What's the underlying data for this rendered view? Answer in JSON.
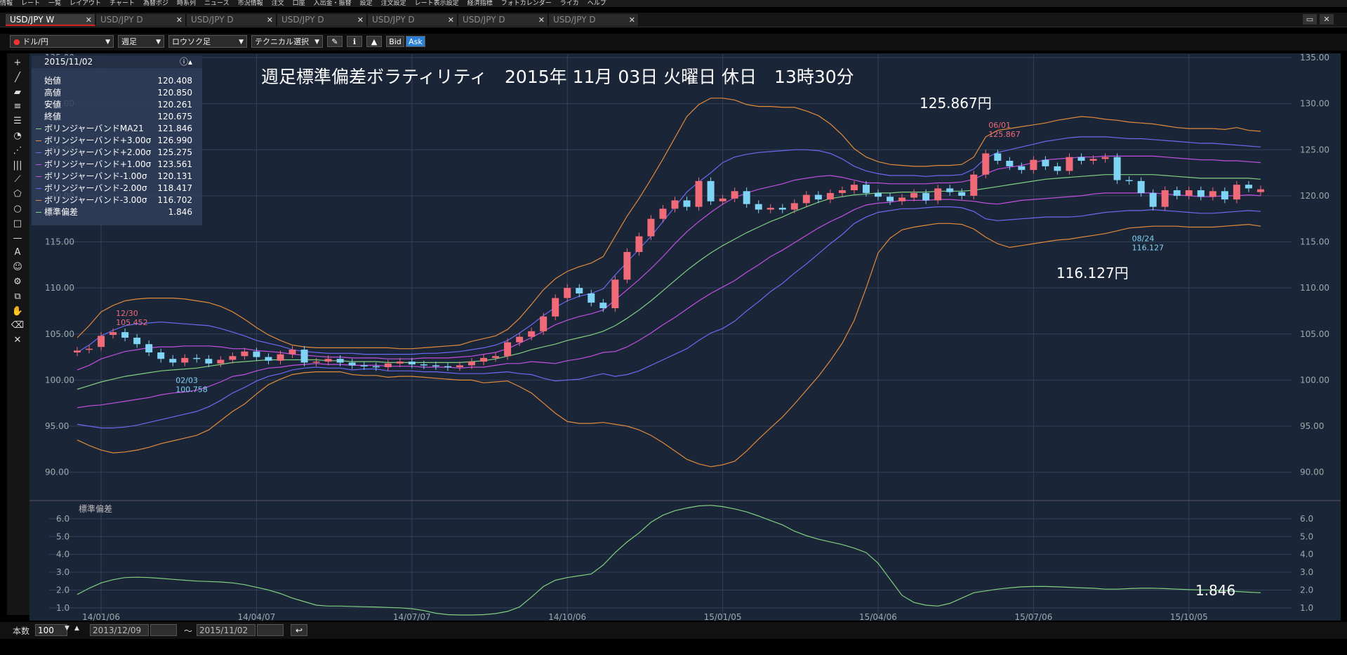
{
  "menu": [
    "情報",
    "レート",
    "一覧",
    "レイアウト",
    "チャート",
    "為替ポジ",
    "時系列",
    "ニュース",
    "市況情報",
    "注文",
    "口座",
    "入出金・振替",
    "設定",
    "注文設定",
    "レート表示設定",
    "経済指標",
    "フォトカレンダー",
    "ライカ",
    "ヘルプ"
  ],
  "tabs": [
    {
      "label": "USD/JPY W",
      "active": true
    },
    {
      "label": "USD/JPY D",
      "active": false
    },
    {
      "label": "USD/JPY D",
      "active": false
    },
    {
      "label": "USD/JPY D",
      "active": false
    },
    {
      "label": "USD/JPY D",
      "active": false
    },
    {
      "label": "USD/JPY D",
      "active": false
    },
    {
      "label": "USD/JPY D",
      "active": false
    }
  ],
  "toolbar": {
    "pair": "ドル/円",
    "period": "週足",
    "chart_type": "ロウソク足",
    "technical": "テクニカル選択",
    "bid": "Bid",
    "ask": "Ask"
  },
  "title": "週足標準偏差ボラティリティ　2015年 11月 03日 火曜日 休日　13時30分",
  "notes": {
    "high": "125.867円",
    "low": "116.127円",
    "std": "1.846"
  },
  "info": {
    "date": "2015/11/02",
    "rows": [
      {
        "label": "始値",
        "value": "120.408",
        "color": ""
      },
      {
        "label": "高値",
        "value": "120.850",
        "color": ""
      },
      {
        "label": "安値",
        "value": "120.261",
        "color": ""
      },
      {
        "label": "終値",
        "value": "120.675",
        "color": ""
      },
      {
        "label": "ボリンジャーバンドMA21",
        "value": "121.846",
        "color": "#7fd07f"
      },
      {
        "label": "ボリンジャーバンド+3.00σ",
        "value": "126.990",
        "color": "#e08a3a"
      },
      {
        "label": "ボリンジャーバンド+2.00σ",
        "value": "125.275",
        "color": "#6a6af0"
      },
      {
        "label": "ボリンジャーバンド+1.00σ",
        "value": "123.561",
        "color": "#c050e0"
      },
      {
        "label": "ボリンジャーバンド-1.00σ",
        "value": "120.131",
        "color": "#c050e0"
      },
      {
        "label": "ボリンジャーバンド-2.00σ",
        "value": "118.417",
        "color": "#6a6af0"
      },
      {
        "label": "ボリンジャーバンド-3.00σ",
        "value": "116.702",
        "color": "#e08a3a"
      },
      {
        "label": "標準偏差",
        "value": "1.846",
        "color": "#7fd07f"
      }
    ]
  },
  "sub_panel_label": "標準偏差",
  "bottom": {
    "count_label": "本数",
    "count": "100",
    "from": "2013/12/09",
    "tilde": "〜",
    "to": "2015/11/02"
  },
  "colors": {
    "up": "#f06a78",
    "down": "#7fd4f5",
    "bg": "#1b2538",
    "ma": "#7fd07f",
    "s3": "#e08a3a",
    "s2": "#6a6af0",
    "s1": "#c050e0"
  },
  "chart_data": {
    "type": "line",
    "ylim": [
      87,
      135
    ],
    "y_ticks": [
      90,
      95,
      100,
      105,
      110,
      115,
      120,
      125,
      130,
      135
    ],
    "x_tick_labels": [
      "14/01/06",
      "14/04/07",
      "14/07/07",
      "14/10/06",
      "15/01/05",
      "15/04/06",
      "15/07/06",
      "15/10/05"
    ],
    "x_tick_index": [
      2,
      15,
      28,
      41,
      54,
      67,
      80,
      93
    ],
    "annotations": [
      {
        "label": "12/30",
        "value": "105.452",
        "index": 3
      },
      {
        "label": "02/03",
        "value": "100.758",
        "index": 8
      },
      {
        "label": "06/01",
        "value": "125.867",
        "index": 76
      },
      {
        "label": "08/24",
        "value": "116.127",
        "index": 88
      }
    ],
    "close": [
      103.2,
      103.4,
      104.8,
      105.2,
      104.6,
      103.9,
      103.0,
      102.3,
      101.9,
      102.4,
      102.3,
      101.8,
      102.2,
      102.6,
      103.1,
      102.5,
      102.1,
      102.8,
      103.3,
      101.9,
      102.0,
      102.3,
      101.9,
      101.6,
      101.5,
      101.4,
      101.8,
      102.0,
      101.7,
      101.6,
      101.5,
      101.4,
      101.6,
      102.0,
      102.4,
      102.6,
      104.1,
      104.7,
      105.3,
      106.9,
      108.9,
      110.0,
      109.4,
      108.4,
      107.8,
      110.9,
      113.9,
      115.6,
      117.5,
      118.6,
      119.5,
      118.8,
      121.6,
      119.4,
      119.7,
      120.5,
      119.1,
      118.5,
      118.7,
      118.5,
      119.2,
      120.1,
      119.6,
      120.3,
      120.6,
      121.2,
      120.3,
      119.9,
      119.4,
      119.8,
      120.3,
      119.5,
      120.8,
      120.4,
      120.0,
      122.3,
      124.6,
      123.8,
      123.2,
      122.8,
      123.9,
      123.2,
      122.7,
      124.2,
      123.8,
      124.0,
      124.2,
      121.7,
      121.6,
      120.3,
      118.8,
      120.6,
      120.0,
      120.6,
      119.9,
      120.5,
      119.6,
      121.2,
      120.8,
      120.7
    ],
    "open": [
      103.0,
      103.3,
      103.6,
      104.9,
      105.2,
      104.6,
      103.9,
      103.0,
      102.3,
      101.9,
      102.4,
      102.3,
      101.8,
      102.2,
      102.6,
      103.1,
      102.5,
      102.1,
      102.8,
      103.3,
      101.9,
      102.0,
      102.3,
      101.9,
      101.6,
      101.5,
      101.4,
      101.8,
      102.0,
      101.7,
      101.6,
      101.5,
      101.4,
      101.6,
      102.0,
      102.4,
      102.6,
      104.1,
      104.7,
      105.3,
      106.9,
      108.9,
      110.0,
      109.4,
      108.4,
      107.8,
      110.9,
      113.9,
      115.6,
      117.5,
      118.6,
      119.5,
      118.8,
      121.6,
      119.4,
      119.7,
      120.5,
      119.1,
      118.5,
      118.7,
      118.5,
      119.2,
      120.1,
      119.6,
      120.3,
      120.6,
      121.2,
      120.3,
      119.9,
      119.4,
      119.8,
      120.3,
      119.5,
      120.8,
      120.4,
      120.0,
      122.3,
      124.6,
      123.8,
      123.2,
      122.8,
      123.9,
      123.2,
      122.7,
      124.2,
      123.8,
      124.0,
      124.2,
      121.7,
      121.6,
      120.3,
      118.8,
      120.6,
      120.0,
      120.6,
      119.9,
      120.5,
      119.6,
      121.2,
      120.4
    ],
    "ma21": [
      99.0,
      99.4,
      99.8,
      100.1,
      100.4,
      100.6,
      100.8,
      101.0,
      101.1,
      101.2,
      101.3,
      101.5,
      101.7,
      101.9,
      102.0,
      102.1,
      102.2,
      102.2,
      102.2,
      102.2,
      102.2,
      102.1,
      102.1,
      102.0,
      102.0,
      102.0,
      101.9,
      101.9,
      101.9,
      101.9,
      101.9,
      101.9,
      101.9,
      102.0,
      102.1,
      102.3,
      102.6,
      102.9,
      103.3,
      103.6,
      103.9,
      104.3,
      104.6,
      104.9,
      105.3,
      105.9,
      106.7,
      107.6,
      108.6,
      109.7,
      110.8,
      111.9,
      112.9,
      113.8,
      114.6,
      115.3,
      116.0,
      116.6,
      117.2,
      117.7,
      118.3,
      118.8,
      119.3,
      119.7,
      119.9,
      120.1,
      120.2,
      120.3,
      120.3,
      120.4,
      120.4,
      120.4,
      120.5,
      120.5,
      120.5,
      120.6,
      120.8,
      121.0,
      121.2,
      121.4,
      121.6,
      121.8,
      121.9,
      122.0,
      122.1,
      122.2,
      122.3,
      122.3,
      122.3,
      122.3,
      122.3,
      122.2,
      122.1,
      122.0,
      121.9,
      121.9,
      121.9,
      121.9,
      121.9,
      121.8
    ],
    "upper3": [
      104.6,
      105.9,
      107.4,
      108.1,
      108.6,
      108.8,
      108.9,
      108.9,
      108.9,
      108.8,
      108.6,
      108.4,
      108.0,
      107.4,
      106.6,
      105.7,
      104.9,
      104.3,
      103.8,
      103.6,
      103.5,
      103.5,
      103.5,
      103.5,
      103.5,
      103.5,
      103.5,
      103.4,
      103.4,
      103.5,
      103.6,
      103.7,
      103.8,
      104.2,
      104.5,
      104.8,
      105.5,
      106.7,
      108.2,
      109.8,
      111.0,
      111.8,
      112.3,
      112.7,
      113.4,
      115.6,
      117.8,
      119.7,
      121.8,
      124.0,
      126.3,
      128.6,
      129.9,
      130.6,
      130.6,
      130.4,
      129.9,
      129.7,
      129.7,
      129.6,
      129.6,
      129.2,
      128.7,
      127.8,
      126.6,
      125.1,
      124.2,
      123.7,
      123.4,
      123.3,
      123.2,
      123.2,
      123.3,
      123.3,
      123.4,
      124.2,
      126.4,
      127.1,
      127.3,
      127.5,
      127.7,
      127.9,
      128.2,
      128.4,
      128.6,
      128.5,
      128.3,
      128.2,
      128.0,
      127.9,
      127.8,
      127.6,
      127.4,
      127.3,
      127.3,
      127.3,
      127.2,
      127.4,
      127.1,
      127.0
    ],
    "upper2": [
      103.0,
      103.8,
      104.8,
      105.4,
      105.9,
      106.1,
      106.2,
      106.3,
      106.2,
      106.1,
      106.0,
      105.9,
      105.6,
      105.2,
      104.8,
      104.3,
      104.0,
      103.7,
      103.3,
      103.1,
      103.0,
      102.9,
      102.9,
      102.9,
      102.8,
      102.8,
      102.8,
      102.8,
      102.8,
      102.9,
      102.9,
      103.0,
      103.1,
      103.3,
      103.5,
      103.8,
      104.3,
      105.1,
      106.0,
      107.0,
      107.9,
      108.6,
      109.1,
      109.4,
      109.9,
      111.4,
      112.8,
      114.2,
      115.6,
      117.2,
      118.8,
      120.4,
      121.5,
      122.5,
      123.6,
      124.2,
      124.5,
      124.7,
      124.8,
      124.9,
      125.0,
      125.0,
      124.9,
      124.6,
      124.0,
      123.2,
      122.7,
      122.4,
      122.2,
      122.2,
      122.2,
      122.1,
      122.2,
      122.2,
      122.3,
      122.9,
      124.1,
      124.7,
      125.0,
      125.3,
      125.6,
      125.9,
      126.1,
      126.3,
      126.4,
      126.4,
      126.4,
      126.3,
      126.2,
      126.2,
      126.1,
      126.0,
      125.9,
      125.8,
      125.7,
      125.7,
      125.6,
      125.5,
      125.4,
      125.3
    ],
    "upper1": [
      101.1,
      101.6,
      102.3,
      102.7,
      103.1,
      103.3,
      103.5,
      103.6,
      103.6,
      103.7,
      103.7,
      103.7,
      103.6,
      103.4,
      103.4,
      103.2,
      103.1,
      103.0,
      102.8,
      102.7,
      102.6,
      102.5,
      102.5,
      102.4,
      102.4,
      102.4,
      102.3,
      102.3,
      102.3,
      102.4,
      102.4,
      102.4,
      102.5,
      102.6,
      102.8,
      103.0,
      103.4,
      104.0,
      104.6,
      105.3,
      106.0,
      106.5,
      106.9,
      107.2,
      107.6,
      108.7,
      109.8,
      110.9,
      112.1,
      113.4,
      114.8,
      116.1,
      117.2,
      118.2,
      119.1,
      119.8,
      120.3,
      120.7,
      121.0,
      121.3,
      121.7,
      121.9,
      122.1,
      122.2,
      122.0,
      121.7,
      121.4,
      121.4,
      121.3,
      121.3,
      121.3,
      121.3,
      121.4,
      121.4,
      121.5,
      121.8,
      122.4,
      122.9,
      123.1,
      123.3,
      123.6,
      123.9,
      124.0,
      124.1,
      124.2,
      124.2,
      124.3,
      124.3,
      124.3,
      124.3,
      124.3,
      124.2,
      124.1,
      124.0,
      123.9,
      123.9,
      123.8,
      123.8,
      123.7,
      123.6
    ],
    "lower1": [
      97.0,
      97.2,
      97.3,
      97.5,
      97.7,
      97.9,
      98.1,
      98.4,
      98.6,
      98.7,
      98.9,
      99.3,
      99.8,
      100.4,
      100.6,
      101.0,
      101.3,
      101.4,
      101.6,
      101.7,
      101.8,
      101.7,
      101.7,
      101.6,
      101.6,
      101.6,
      101.5,
      101.5,
      101.5,
      101.4,
      101.4,
      101.4,
      101.3,
      101.4,
      101.4,
      101.6,
      101.8,
      101.8,
      102.0,
      101.9,
      101.8,
      102.1,
      102.3,
      102.6,
      103.0,
      103.1,
      103.6,
      104.3,
      105.1,
      106.0,
      106.8,
      107.7,
      108.6,
      109.4,
      110.1,
      110.8,
      111.7,
      112.5,
      113.4,
      114.1,
      114.9,
      115.7,
      116.5,
      117.2,
      117.8,
      118.5,
      119.0,
      119.2,
      119.3,
      119.5,
      119.5,
      119.5,
      119.6,
      119.6,
      119.5,
      119.4,
      119.2,
      119.1,
      119.3,
      119.5,
      119.6,
      119.7,
      119.8,
      119.9,
      120.0,
      120.2,
      120.3,
      120.3,
      120.3,
      120.3,
      120.3,
      120.2,
      120.1,
      120.0,
      119.9,
      119.9,
      120.0,
      120.0,
      120.1,
      120.0
    ],
    "lower2": [
      95.2,
      95.0,
      94.8,
      94.8,
      94.9,
      95.1,
      95.4,
      95.7,
      96.0,
      96.3,
      96.6,
      97.1,
      97.8,
      98.6,
      99.2,
      99.9,
      100.4,
      100.7,
      101.1,
      101.3,
      101.4,
      101.3,
      101.3,
      101.1,
      101.2,
      101.2,
      101.0,
      101.0,
      101.0,
      100.9,
      100.9,
      100.8,
      100.7,
      100.7,
      100.7,
      100.8,
      100.9,
      100.7,
      100.6,
      100.2,
      99.9,
      100.0,
      100.1,
      100.4,
      100.7,
      100.4,
      100.6,
      101.0,
      101.6,
      102.2,
      102.8,
      103.4,
      104.3,
      105.1,
      105.6,
      106.4,
      107.5,
      108.5,
      109.6,
      110.5,
      111.6,
      112.6,
      113.7,
      114.8,
      115.8,
      117.0,
      117.7,
      118.2,
      118.4,
      118.6,
      118.6,
      118.7,
      118.8,
      118.8,
      118.7,
      118.3,
      117.5,
      117.3,
      117.4,
      117.5,
      117.6,
      117.7,
      117.7,
      117.7,
      117.8,
      118.0,
      118.2,
      118.3,
      118.4,
      118.4,
      118.5,
      118.4,
      118.3,
      118.2,
      118.1,
      118.1,
      118.2,
      118.3,
      118.4,
      118.3
    ],
    "lower3": [
      93.5,
      92.9,
      92.4,
      92.1,
      92.2,
      92.4,
      92.7,
      93.1,
      93.4,
      93.7,
      94.0,
      94.6,
      95.6,
      96.6,
      97.4,
      98.5,
      99.5,
      100.1,
      100.6,
      100.8,
      100.9,
      100.9,
      100.9,
      100.6,
      100.5,
      100.5,
      100.3,
      100.4,
      100.4,
      100.3,
      100.2,
      100.1,
      100.0,
      100.0,
      99.7,
      99.8,
      99.9,
      99.3,
      98.6,
      97.5,
      96.4,
      95.5,
      95.3,
      95.3,
      95.4,
      95.2,
      95.0,
      94.6,
      94.0,
      93.2,
      92.3,
      91.4,
      90.9,
      90.6,
      90.8,
      91.2,
      92.3,
      93.6,
      94.8,
      96.0,
      97.4,
      98.9,
      100.4,
      102.1,
      104.0,
      106.5,
      110.0,
      113.8,
      115.4,
      116.3,
      116.6,
      116.8,
      117.0,
      117.0,
      116.9,
      116.4,
      115.5,
      114.8,
      114.4,
      114.6,
      114.8,
      115.0,
      115.2,
      115.3,
      115.5,
      115.7,
      115.9,
      116.2,
      116.5,
      116.6,
      116.7,
      116.7,
      116.7,
      116.6,
      116.6,
      116.6,
      116.7,
      116.8,
      116.9,
      116.7
    ],
    "stddev": [
      1.75,
      2.1,
      2.4,
      2.58,
      2.7,
      2.72,
      2.7,
      2.65,
      2.6,
      2.55,
      2.5,
      2.48,
      2.45,
      2.4,
      2.3,
      2.15,
      2.0,
      1.8,
      1.55,
      1.35,
      1.15,
      1.1,
      1.1,
      1.08,
      1.06,
      1.05,
      1.02,
      1.0,
      0.95,
      0.85,
      0.7,
      0.62,
      0.6,
      0.6,
      0.62,
      0.68,
      0.8,
      1.05,
      1.6,
      2.2,
      2.55,
      2.7,
      2.8,
      2.9,
      3.4,
      4.1,
      4.7,
      5.2,
      5.8,
      6.2,
      6.45,
      6.6,
      6.72,
      6.75,
      6.68,
      6.55,
      6.38,
      6.15,
      5.9,
      5.65,
      5.3,
      5.05,
      4.85,
      4.7,
      4.55,
      4.35,
      4.1,
      3.5,
      2.6,
      1.7,
      1.3,
      1.15,
      1.1,
      1.25,
      1.55,
      1.85,
      1.95,
      2.05,
      2.12,
      2.18,
      2.2,
      2.2,
      2.18,
      2.15,
      2.12,
      2.1,
      2.05,
      2.05,
      2.08,
      2.1,
      2.1,
      2.08,
      2.05,
      2.02,
      2.0,
      2.0,
      1.98,
      1.92,
      1.88,
      1.85
    ],
    "sub_ylim": [
      0.6,
      6.9
    ],
    "sub_ticks": [
      1.0,
      2.0,
      3.0,
      4.0,
      5.0,
      6.0
    ]
  }
}
